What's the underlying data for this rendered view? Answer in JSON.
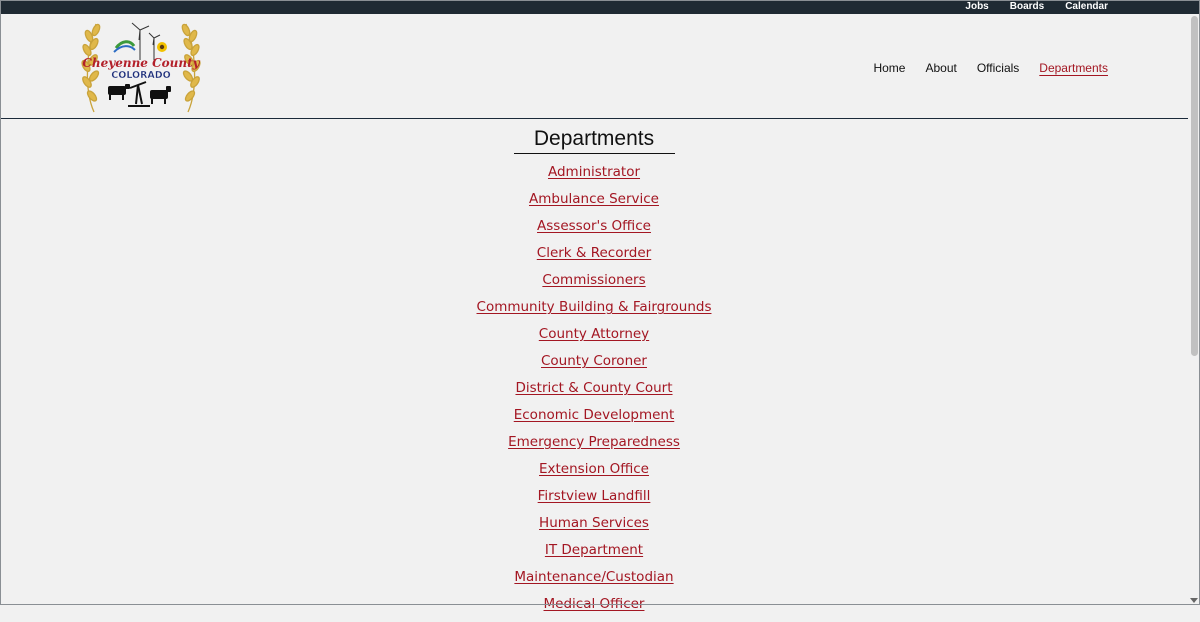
{
  "topbar": {
    "links": [
      "Jobs",
      "Boards",
      "Calendar"
    ]
  },
  "logo": {
    "alt": "Cheyenne County Colorado logo",
    "line1": "Cheyenne County",
    "line2": "COLORADO"
  },
  "nav": {
    "items": [
      "Home",
      "About",
      "Officials",
      "Departments"
    ],
    "active": "Departments"
  },
  "page": {
    "title": "Departments"
  },
  "departments": [
    "Administrator",
    "Ambulance Service",
    "Assessor's Office",
    "Clerk & Recorder",
    "Commissioners",
    "Community Building & Fairgrounds",
    "County Attorney",
    "County Coroner",
    "District & County Court",
    "Economic Development",
    "Emergency Preparedness",
    "Extension Office",
    "Firstview Landfill",
    "Human Services",
    "IT Department",
    "Maintenance/Custodian",
    "Medical Officer"
  ],
  "colors": {
    "topbar": "#1f2a33",
    "link": "#a31622",
    "background": "#f1f1f1"
  }
}
